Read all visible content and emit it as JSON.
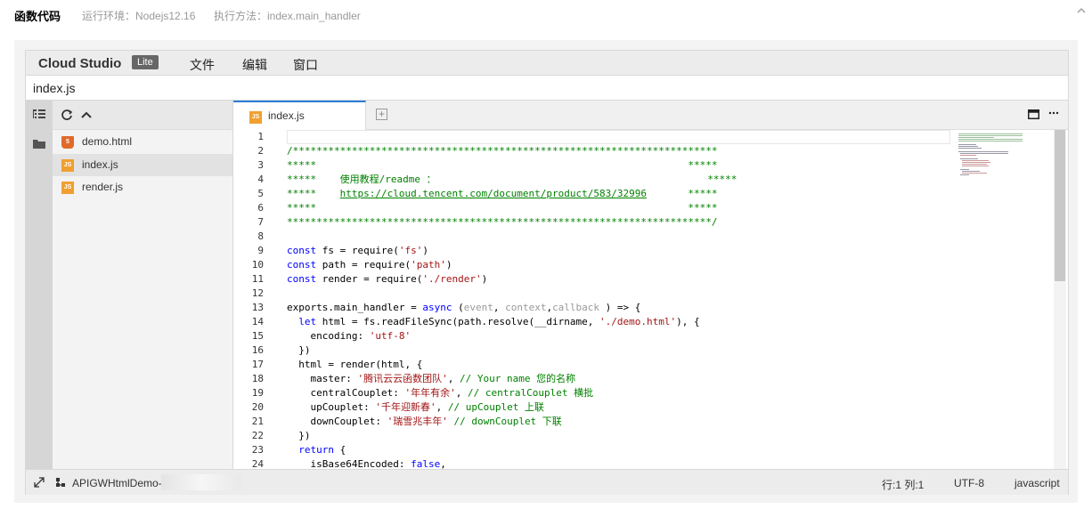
{
  "header": {
    "title": "函数代码",
    "runtime": "运行环境：Nodejs12.16",
    "handler": "执行方法：index.main_handler"
  },
  "ide": {
    "brand": "Cloud Studio",
    "badge": "Lite",
    "menu": [
      "文件",
      "编辑",
      "窗口"
    ],
    "path": "index.js"
  },
  "explorer": {
    "files": [
      {
        "name": "demo.html",
        "type": "html",
        "icon": "html5-icon"
      },
      {
        "name": "index.js",
        "type": "js",
        "icon": "js-icon"
      },
      {
        "name": "render.js",
        "type": "js",
        "icon": "js-icon"
      }
    ],
    "icon_label": "JS"
  },
  "tab": {
    "label": "index.js"
  },
  "editor": {
    "line_numbers": [
      "1",
      "2",
      "3",
      "4",
      "5",
      "6",
      "7",
      "8",
      "9",
      "10",
      "11",
      "12",
      "13",
      "14",
      "15",
      "16",
      "17",
      "18",
      "19",
      "20",
      "21",
      "22",
      "23",
      "24"
    ]
  },
  "status": {
    "project": "APIGWHtmlDemo-",
    "position": "行:1 列:1",
    "encoding": "UTF-8",
    "language": "javascript"
  },
  "colors": {
    "accent": "#2b7dd6",
    "comment": "#008000",
    "keyword": "#0000ff",
    "string": "#a31515"
  }
}
